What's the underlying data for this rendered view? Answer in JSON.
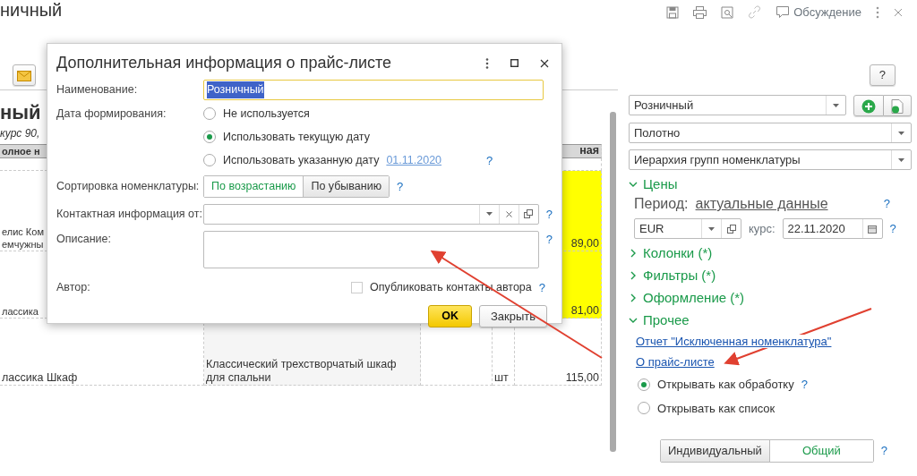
{
  "page": {
    "title": "ничный",
    "discussion": "Обсуждение",
    "help_button": "?"
  },
  "report": {
    "title": "ный",
    "subtitle": "курс 90,",
    "header": [
      "олное н",
      "ная"
    ],
    "rows": [
      {
        "name": [
          "елис Ком",
          "емчужны"
        ],
        "description": "",
        "unit": "",
        "price": "89,00",
        "highlighted": true
      },
      {
        "name": [
          "лассика"
        ],
        "description": "",
        "unit": "",
        "price": "81,00",
        "highlighted": true
      },
      {
        "name": [
          "лассика Шкаф"
        ],
        "description": "Классический трехстворчатый шкаф для спальни",
        "unit": "шт",
        "price": "115,00",
        "highlighted": false
      }
    ]
  },
  "settings": {
    "price_type": "Розничный",
    "layout": "Полотно",
    "grouping": "Иерархия групп номенклатуры",
    "prices_section": {
      "label": "Цены",
      "expanded": true,
      "period_label": "Период:",
      "period_value": "актуальные данные",
      "help": "?",
      "currency": "EUR",
      "rate_label": "курс:",
      "rate_date": "22.11.2020",
      "rate_help": "?"
    },
    "sections": [
      {
        "label": "Колонки (*)",
        "expanded": false
      },
      {
        "label": "Фильтры (*)",
        "expanded": false
      },
      {
        "label": "Оформление (*)",
        "expanded": false
      }
    ],
    "other_section": {
      "label": "Прочее",
      "expanded": true,
      "links": [
        "Отчет \"Исключенная номенклатура\"",
        "О прайс-листе"
      ],
      "open_options": [
        {
          "label": "Открывать как обработку",
          "selected": true
        },
        {
          "label": "Открывать как список",
          "selected": false
        }
      ],
      "help": "?"
    },
    "mode_options": [
      {
        "label": "Индивидуальный",
        "selected": false
      },
      {
        "label": "Общий",
        "selected": true
      }
    ],
    "mode_help": "?"
  },
  "dialog": {
    "title": "Дополнительная информация о прайс-листе",
    "name_label": "Наименование:",
    "name_value": "Розничный",
    "date_label": "Дата формирования:",
    "date_options": [
      {
        "label": "Не используется",
        "selected": false
      },
      {
        "label": "Использовать текущую дату",
        "selected": true
      },
      {
        "label": "Использовать указанную дату",
        "selected": false,
        "date": "01.11.2020",
        "help": "?"
      }
    ],
    "sort_label": "Сортировка номенклатуры:",
    "sort_options": [
      {
        "label": "По возрастанию",
        "selected": true
      },
      {
        "label": "По убыванию",
        "selected": false
      }
    ],
    "sort_help": "?",
    "contact_label": "Контактная информация от:",
    "contact_help": "?",
    "description_label": "Описание:",
    "description_help": "?",
    "author_label": "Автор:",
    "publish": {
      "label": "Опубликовать контакты автора",
      "checked": false
    },
    "publish_help": "?",
    "ok": "OK",
    "close": "Закрыть"
  }
}
